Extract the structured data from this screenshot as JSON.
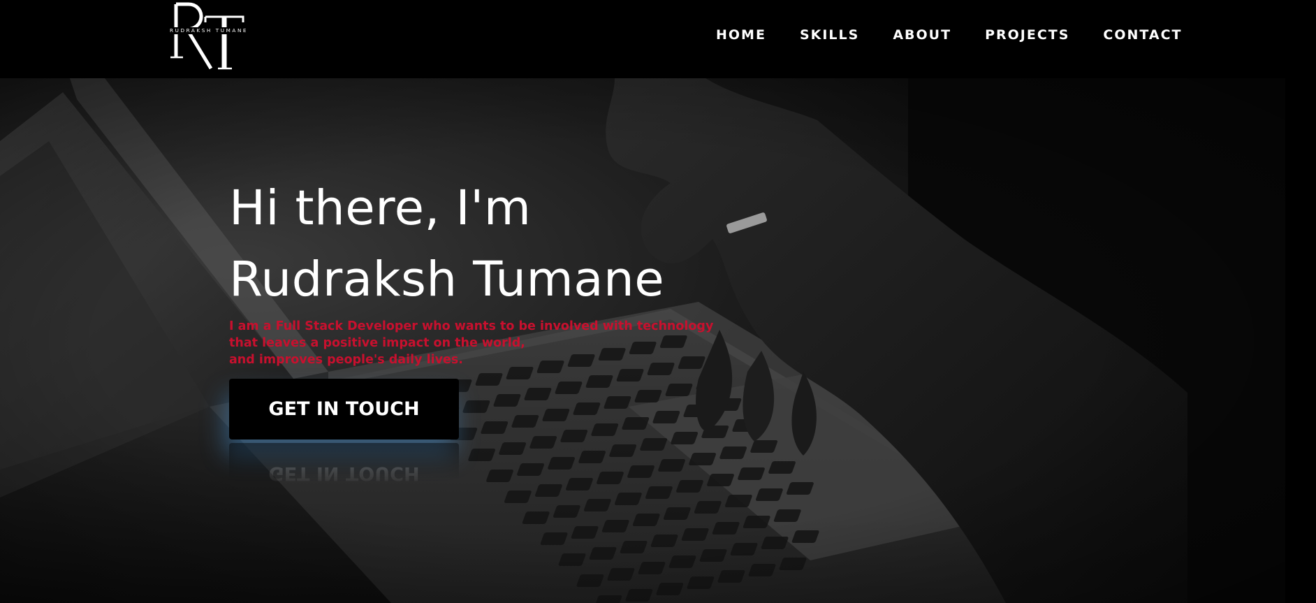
{
  "logo": {
    "monogram": "RT",
    "name": "RUDRAKSH TUMANE"
  },
  "nav": {
    "items": [
      "HOME",
      "SKILLS",
      "ABOUT",
      "PROJECTS",
      "CONTACT"
    ]
  },
  "hero": {
    "title_line1": "Hi there, I'm",
    "title_line2": "Rudraksh Tumane",
    "tagline_line1": "I am a Full Stack Developer who wants to be involved with technology",
    "tagline_line2": "that leaves a positive impact on the world,",
    "tagline_line3": "and improves people's daily lives.",
    "cta_label": "GET IN TOUCH"
  },
  "colors": {
    "background": "#000000",
    "text": "#ffffff",
    "accent": "#c8102e",
    "button_glow": "#4696dc"
  }
}
